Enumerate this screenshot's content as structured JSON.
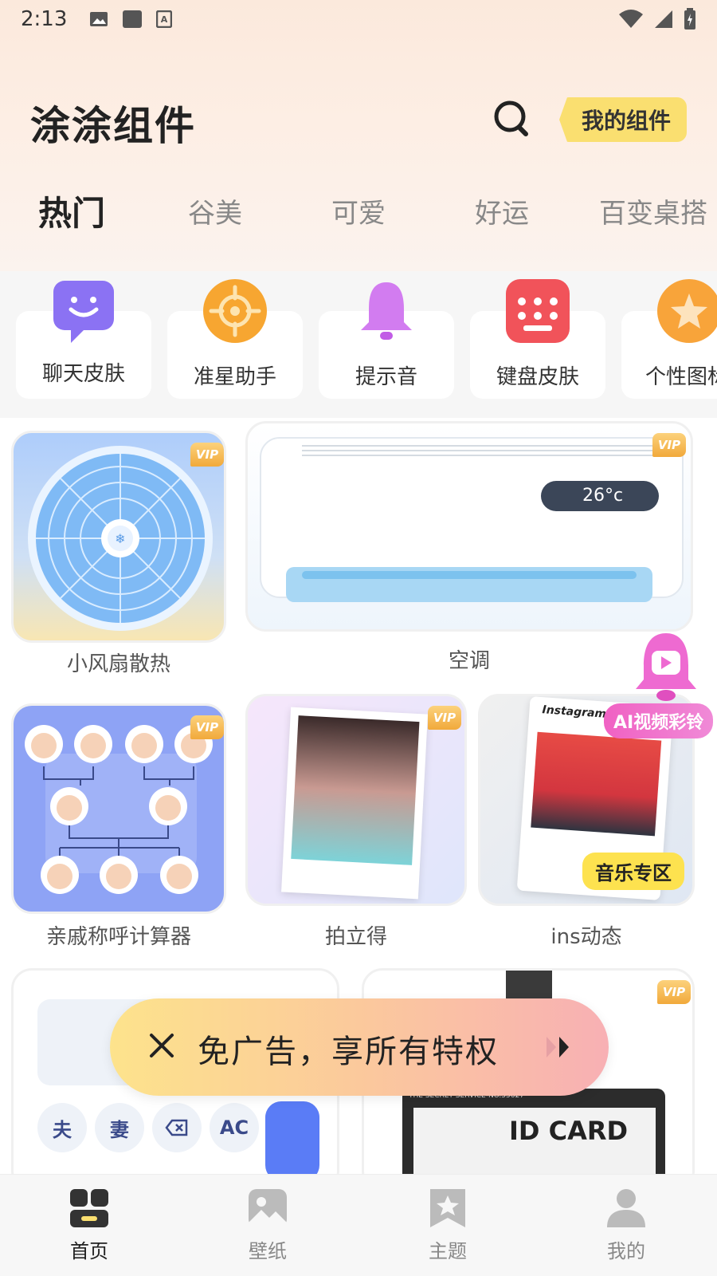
{
  "status_bar": {
    "time": "2:13"
  },
  "header": {
    "app_title": "涂涂组件",
    "my_widgets_label": "我的组件"
  },
  "tabs": [
    {
      "label": "热门",
      "active": true
    },
    {
      "label": "谷美"
    },
    {
      "label": "可爱"
    },
    {
      "label": "好运"
    },
    {
      "label": "百变桌搭"
    }
  ],
  "categories": [
    {
      "label": "聊天皮肤",
      "icon": "chat-bubble-icon",
      "color": "#8b72f3"
    },
    {
      "label": "准星助手",
      "icon": "crosshair-icon",
      "color": "#f7a631"
    },
    {
      "label": "提示音",
      "icon": "bell-icon",
      "color": "#d27cf0"
    },
    {
      "label": "键盘皮肤",
      "icon": "keyboard-icon",
      "color": "#f1535a"
    },
    {
      "label": "个性图标",
      "icon": "star-icon",
      "color": "#f8a43a"
    }
  ],
  "widgets": [
    {
      "label": "小风扇散热",
      "vip": "VIP"
    },
    {
      "label": "空调",
      "vip": "VIP",
      "ac_display": "26°c"
    },
    {
      "label": "亲戚称呼计算器",
      "vip": "VIP"
    },
    {
      "label": "拍立得",
      "vip": "VIP"
    },
    {
      "label": "ins动态",
      "instagram_text": "Instagram",
      "badge": "音乐专区"
    },
    {
      "keys": [
        "夫",
        "妻",
        "AC"
      ]
    },
    {
      "vip": "VIP",
      "card_top_text": "THE SECRET SERVICE-NO.55627",
      "card_title": "ID CARD"
    }
  ],
  "float_promo": {
    "label": "AI视频彩铃"
  },
  "ad_bar": {
    "text": "免广告，享所有特权"
  },
  "bottom_nav": [
    {
      "label": "首页",
      "icon": "home-grid-icon",
      "active": true
    },
    {
      "label": "壁纸",
      "icon": "wallpaper-icon"
    },
    {
      "label": "主题",
      "icon": "theme-bookmark-icon"
    },
    {
      "label": "我的",
      "icon": "profile-icon"
    }
  ],
  "colors": {
    "accent_yellow": "#fadf70",
    "vip_gold": "#f1a93b",
    "pink": "#f061c3"
  }
}
